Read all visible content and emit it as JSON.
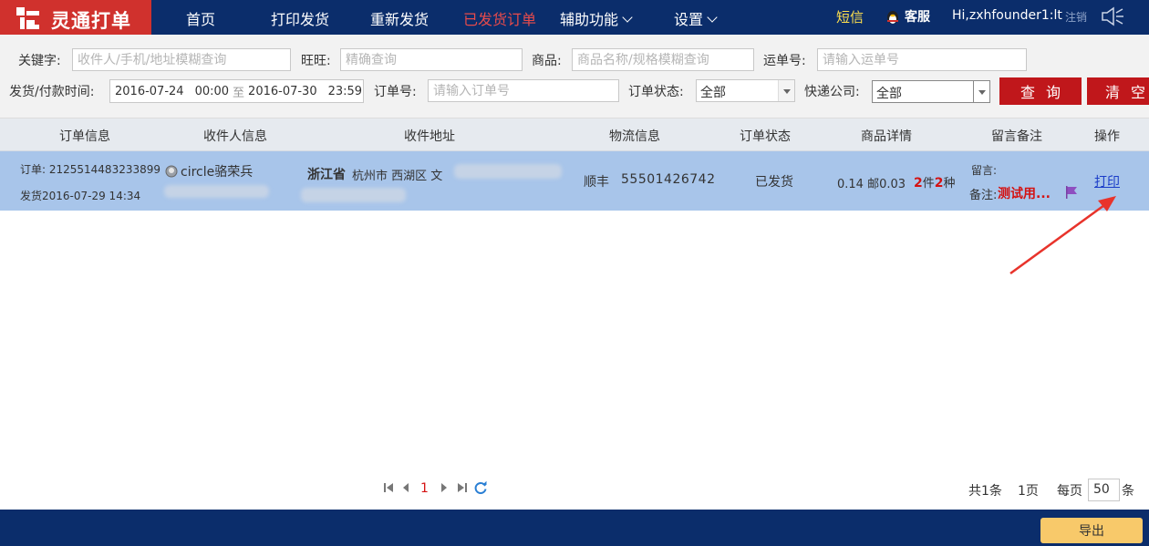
{
  "app": {
    "logo_text": "灵通打单"
  },
  "nav": {
    "items": [
      "首页",
      "打印发货",
      "重新发货",
      "已发货订单",
      "辅助功能",
      "设置"
    ],
    "active_index": 3,
    "sms": "短信",
    "service": "客服",
    "greeting": "Hi,zxhfounder1:lt",
    "logout": "注销"
  },
  "filters": {
    "keyword_label": "关键字:",
    "keyword_placeholder": "收件人/手机/地址模糊查询",
    "wangwang_label": "旺旺:",
    "wangwang_placeholder": "精确查询",
    "product_label": "商品:",
    "product_placeholder": "商品名称/规格模糊查询",
    "waybill_label": "运单号:",
    "waybill_placeholder": "请输入运单号",
    "time_label": "发货/付款时间:",
    "date_from": "2016-07-24",
    "time_from": "00:00",
    "to_text": "至",
    "date_to": "2016-07-30",
    "time_to": "23:59",
    "order_label": "订单号:",
    "order_placeholder": "请输入订单号",
    "status_label": "订单状态:",
    "status_value": "全部",
    "express_label": "快递公司:",
    "express_value": "全部",
    "query_button": "查询",
    "clear_button": "清空"
  },
  "table": {
    "headers": [
      "订单信息",
      "收件人信息",
      "收件地址",
      "物流信息",
      "订单状态",
      "商品详情",
      "留言备注",
      "操作"
    ],
    "row": {
      "order_label": "订单: 2125514483233899",
      "shipped": "发货2016-07-29 14:34",
      "recipient": "circle骆荣兵",
      "province": "浙江省",
      "city": "杭州市 西湖区 文",
      "courier": "顺丰",
      "tracking": "55501426742",
      "status": "已发货",
      "price": "0.14 邮0.03",
      "qty_num": "2",
      "qty_unit": "件",
      "kind_num": "2",
      "kind_unit": "种",
      "message_label": "留言:",
      "remark_label": "备注:",
      "remark_text": "测试用...",
      "action": "打印"
    }
  },
  "pager": {
    "current_page": "1",
    "total_records": "共1条",
    "total_pages": "1页",
    "per_page_label": "每页",
    "per_page_value": "50",
    "per_page_unit": "条"
  },
  "footer": {
    "export_button": "导出"
  },
  "colors": {
    "nav": "#0b2d6b",
    "logo": "#d0312d",
    "accent_red": "#c0171b",
    "row_selected": "#a8c5ea",
    "export": "#f8c96a"
  }
}
